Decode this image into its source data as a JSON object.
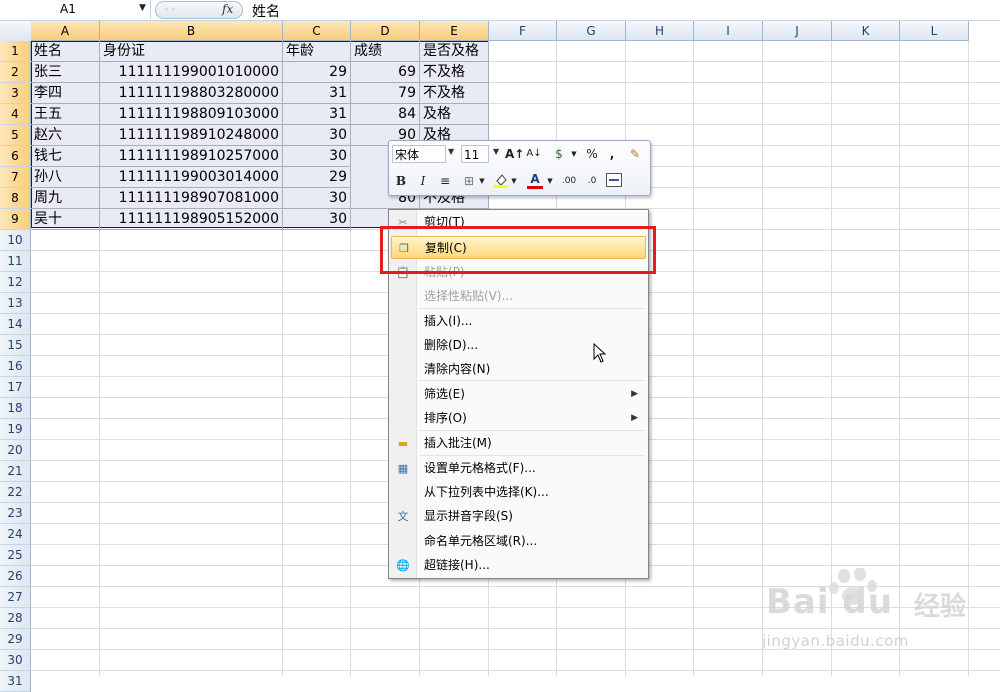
{
  "formula_bar": {
    "name_box": "A1",
    "fx_label": "fx",
    "content": "姓名"
  },
  "columns": [
    {
      "label": "A",
      "selected": true
    },
    {
      "label": "B",
      "selected": true
    },
    {
      "label": "C",
      "selected": true
    },
    {
      "label": "D",
      "selected": true
    },
    {
      "label": "E",
      "selected": true
    },
    {
      "label": "F",
      "selected": false
    },
    {
      "label": "G",
      "selected": false
    },
    {
      "label": "H",
      "selected": false
    },
    {
      "label": "I",
      "selected": false
    },
    {
      "label": "J",
      "selected": false
    },
    {
      "label": "K",
      "selected": false
    },
    {
      "label": "L",
      "selected": false
    }
  ],
  "row_count": 31,
  "selected_rows": 9,
  "table": {
    "header": [
      "姓名",
      "身份证",
      "年龄",
      "成绩",
      "是否及格"
    ],
    "rows": [
      [
        "张三",
        "111111199001010000",
        "29",
        "69",
        "不及格"
      ],
      [
        "李四",
        "111111198803280000",
        "31",
        "79",
        "不及格"
      ],
      [
        "王五",
        "111111198809103000",
        "31",
        "84",
        "及格"
      ],
      [
        "赵六",
        "111111198910248000",
        "30",
        "90",
        "及格"
      ],
      [
        "钱七",
        "111111198910257000",
        "30",
        "",
        ""
      ],
      [
        "孙八",
        "111111199003014000",
        "29",
        "",
        ""
      ],
      [
        "周九",
        "111111198907081000",
        "30",
        "80",
        "不及格"
      ],
      [
        "吴十",
        "111111198905152000",
        "30",
        "",
        ""
      ]
    ]
  },
  "mini_toolbar": {
    "font_name": "宋体",
    "font_size": "11",
    "buttons": [
      "A↑",
      "A↓",
      "$",
      "%",
      ",",
      "B",
      "I",
      "≡",
      "⊞",
      "A",
      ".00",
      ".0"
    ]
  },
  "context_menu": [
    {
      "label": "剪切(T)",
      "icon": "scissors-icon",
      "disabled": false,
      "highlighted": false,
      "submenu": false
    },
    {
      "label": "复制(C)",
      "icon": "copy-icon",
      "disabled": false,
      "highlighted": true,
      "submenu": false
    },
    {
      "label": "粘贴(P)",
      "icon": "paste-icon",
      "disabled": true,
      "highlighted": false,
      "submenu": false
    },
    {
      "label": "选择性粘贴(V)...",
      "icon": "",
      "disabled": true,
      "highlighted": false,
      "submenu": false
    },
    {
      "label": "插入(I)...",
      "icon": "",
      "disabled": false,
      "highlighted": false,
      "submenu": false
    },
    {
      "label": "删除(D)...",
      "icon": "",
      "disabled": false,
      "highlighted": false,
      "submenu": false
    },
    {
      "label": "清除内容(N)",
      "icon": "",
      "disabled": false,
      "highlighted": false,
      "submenu": false
    },
    {
      "label": "筛选(E)",
      "icon": "",
      "disabled": false,
      "highlighted": false,
      "submenu": true
    },
    {
      "label": "排序(O)",
      "icon": "",
      "disabled": false,
      "highlighted": false,
      "submenu": true
    },
    {
      "label": "插入批注(M)",
      "icon": "comment-icon",
      "disabled": false,
      "highlighted": false,
      "submenu": false
    },
    {
      "label": "设置单元格格式(F)...",
      "icon": "format-cells-icon",
      "disabled": false,
      "highlighted": false,
      "submenu": false
    },
    {
      "label": "从下拉列表中选择(K)...",
      "icon": "",
      "disabled": false,
      "highlighted": false,
      "submenu": false
    },
    {
      "label": "显示拼音字段(S)",
      "icon": "phonetic-icon",
      "disabled": false,
      "highlighted": false,
      "submenu": false
    },
    {
      "label": "命名单元格区域(R)...",
      "icon": "",
      "disabled": false,
      "highlighted": false,
      "submenu": false
    },
    {
      "label": "超链接(H)...",
      "icon": "hyperlink-icon",
      "disabled": false,
      "highlighted": false,
      "submenu": false
    }
  ],
  "watermark": {
    "brand": "Bai du",
    "cn": "经验",
    "url": "jingyan.baidu.com"
  },
  "colors": {
    "highlight_box": "#e01e1e",
    "selection_fill": "#e8ebf5",
    "header_selected": "#f9cd7a"
  }
}
